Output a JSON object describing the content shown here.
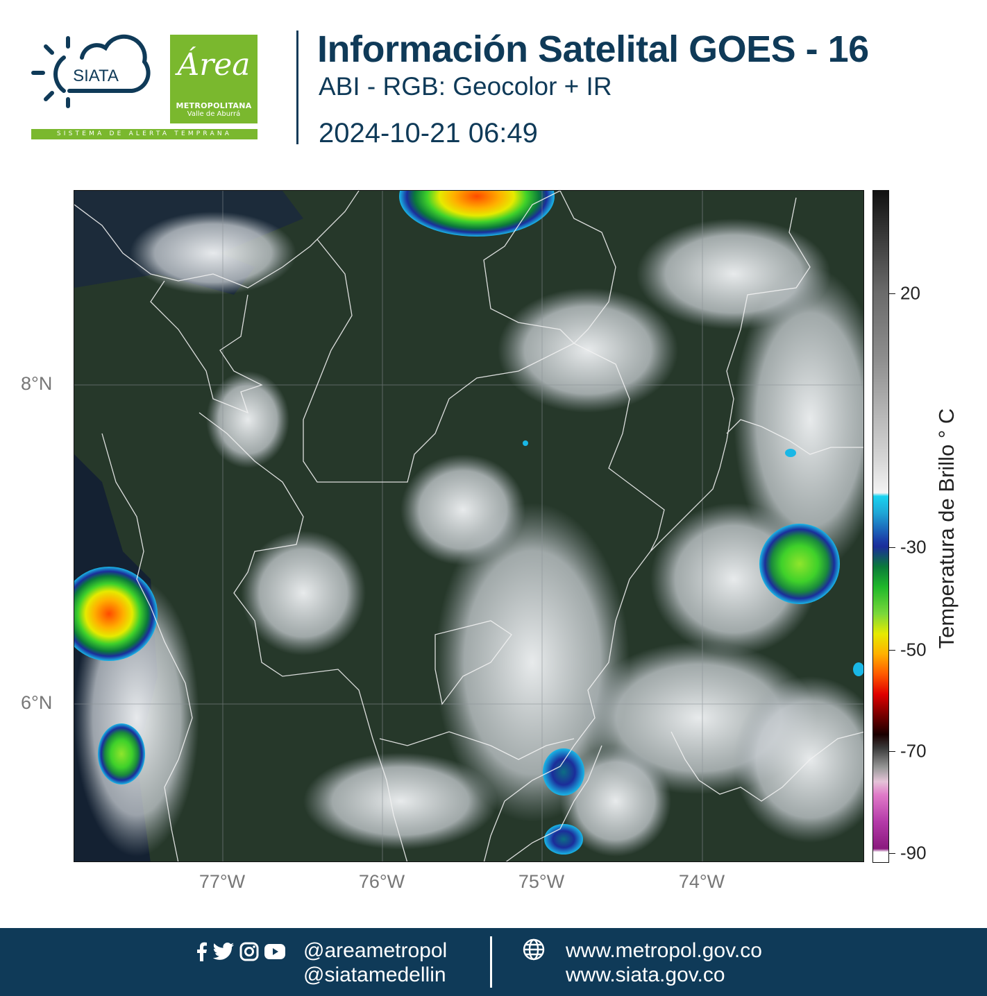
{
  "header": {
    "siata_logo_text": "SIATA",
    "area_logo_script": "Área",
    "area_logo_line1": "METROPOLITANA",
    "area_logo_line2": "Valle de Aburrá",
    "siata_tagline": "SISTEMA DE ALERTA TEMPRANA",
    "title": "Información Satelital GOES - 16",
    "subtitle": "ABI - RGB: Geocolor + IR",
    "timestamp": "2024-10-21 06:49"
  },
  "map": {
    "lat_labels": [
      "8°N",
      "6°N"
    ],
    "lon_labels": [
      "77°W",
      "76°W",
      "75°W",
      "74°W"
    ],
    "colors": {
      "land": "#26382a",
      "cloud": "#d6d9dc",
      "border": "#f2f2f2",
      "grid": "#8a9196"
    }
  },
  "colorbar": {
    "title": "Temperatura de Brillo ° C",
    "ticks": [
      "20",
      "-30",
      "-50",
      "-70",
      "-90"
    ]
  },
  "footer": {
    "icons": [
      "facebook-icon",
      "twitter-icon",
      "instagram-icon",
      "youtube-icon"
    ],
    "handle1": "@areametropol",
    "handle2": "@siatamedellin",
    "url1": "www.metropol.gov.co",
    "url2": "www.siata.gov.co",
    "background": "#0f3a58"
  }
}
